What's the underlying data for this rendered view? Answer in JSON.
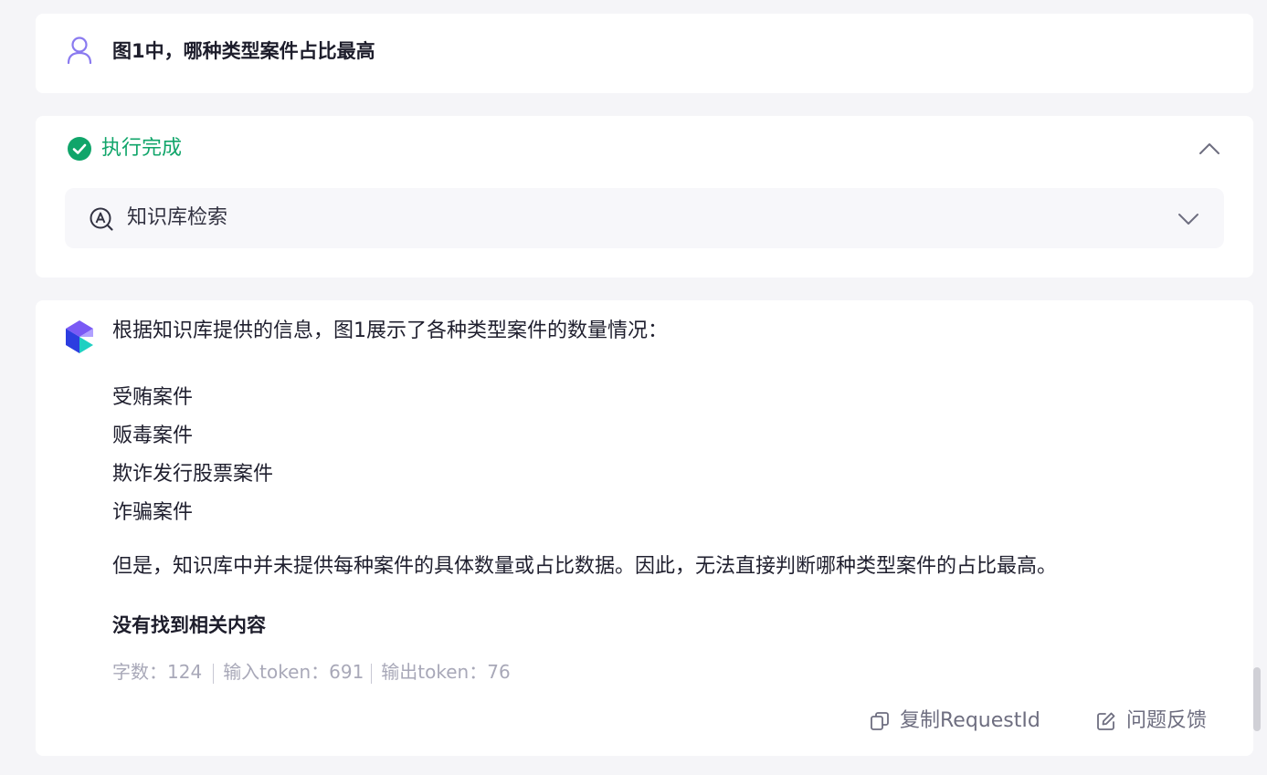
{
  "question": {
    "text": "图1中，哪种类型案件占比最高",
    "icon": "user-icon"
  },
  "status": {
    "text": "执行完成",
    "icon": "check-circle-icon",
    "color": "#10a56a",
    "toggle_icon": "chevron-up-icon",
    "tool": {
      "label": "知识库检索",
      "icon": "knowledge-search-icon",
      "toggle_icon": "chevron-down-icon"
    }
  },
  "answer": {
    "logo": "bot-logo-icon",
    "intro": "根据知识库提供的信息，图1展示了各种类型案件的数量情况：",
    "cases": [
      "受贿案件",
      "贩毒案件",
      "欺诈发行股票案件",
      "诈骗案件"
    ],
    "conclusion": "但是，知识库中并未提供每种案件的具体数量或占比数据。因此，无法直接判断哪种类型案件的占比最高。",
    "bold_note": "没有找到相关内容",
    "stats": {
      "word_count": "字数：124",
      "input_tokens": "输入token：691",
      "output_tokens": "输出token：76"
    },
    "actions": {
      "copy_label": "复制RequestId",
      "copy_icon": "copy-icon",
      "feedback_label": "问题反馈",
      "feedback_icon": "edit-icon"
    }
  }
}
